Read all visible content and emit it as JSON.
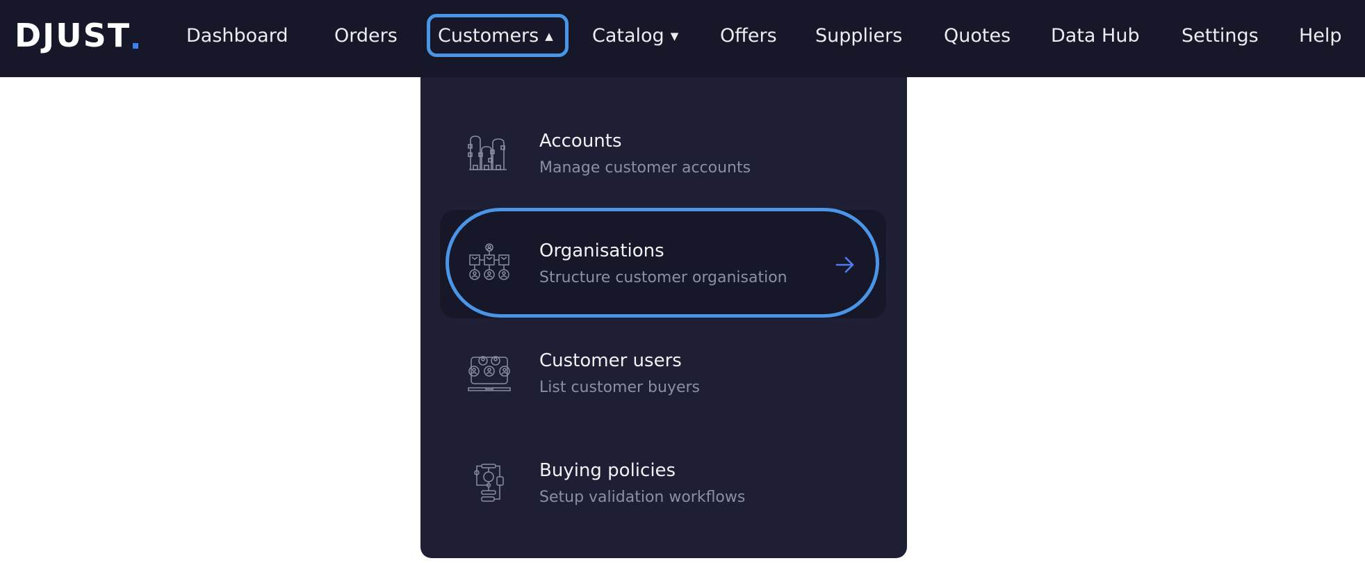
{
  "brand": {
    "name": "DJUST",
    "accent_color": "#3b82f6"
  },
  "nav": {
    "items": [
      {
        "label": "Dashboard"
      },
      {
        "label": "Orders"
      },
      {
        "label": "Customers",
        "caret": "▲",
        "active": true
      },
      {
        "label": "Catalog",
        "caret": "▼"
      },
      {
        "label": "Offers"
      },
      {
        "label": "Suppliers"
      },
      {
        "label": "Quotes"
      },
      {
        "label": "Data Hub"
      },
      {
        "label": "Settings"
      },
      {
        "label": "Help"
      }
    ]
  },
  "dropdown": {
    "items": [
      {
        "title": "Accounts",
        "subtitle": "Manage customer accounts",
        "icon": "buildings-icon"
      },
      {
        "title": "Organisations",
        "subtitle": "Structure customer organisation",
        "icon": "org-chart-icon",
        "hovered": true,
        "arrow": "arrow-right-icon"
      },
      {
        "title": "Customer users",
        "subtitle": "List customer buyers",
        "icon": "users-laptop-icon"
      },
      {
        "title": "Buying policies",
        "subtitle": "Setup validation workflows",
        "icon": "workflow-icon"
      }
    ]
  },
  "colors": {
    "navbar_bg": "#161729",
    "dropdown_bg": "#1e1e34",
    "focus_ring": "#4a95e6",
    "arrow": "#4f7cf0"
  }
}
